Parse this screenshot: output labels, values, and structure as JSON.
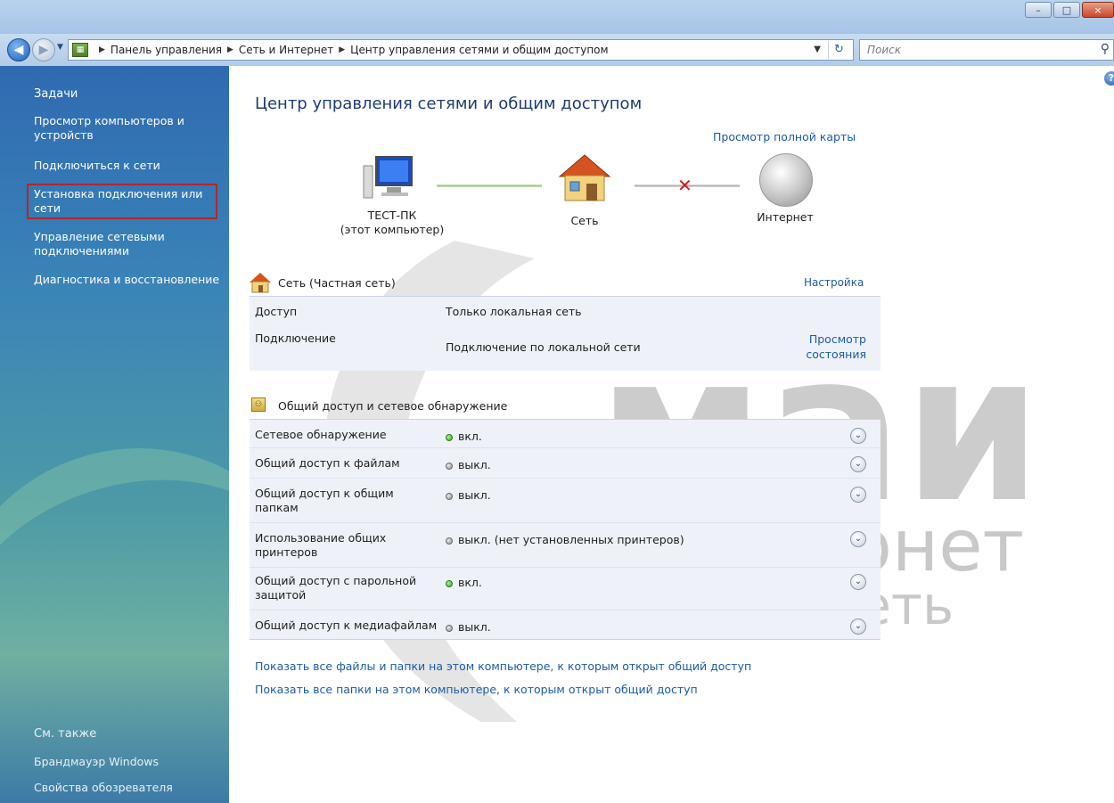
{
  "window": {
    "buttons": {
      "minimize": "–",
      "maximize": "□",
      "close": "×"
    }
  },
  "address_bar": {
    "crumbs": [
      "Панель управления",
      "Сеть и Интернет",
      "Центр управления сетями и общим доступом"
    ],
    "search_placeholder": "Поиск"
  },
  "sidebar": {
    "tasks_header": "Задачи",
    "items": [
      {
        "label": "Просмотр компьютеров и устройств"
      },
      {
        "label": "Подключиться к сети"
      },
      {
        "label": "Установка подключения или сети"
      },
      {
        "label": "Управление сетевыми подключениями"
      },
      {
        "label": "Диагностика и восстановление"
      }
    ],
    "see_also_header": "См. также",
    "see_also": [
      {
        "label": "Брандмауэр Windows"
      },
      {
        "label": "Свойства обозревателя"
      }
    ]
  },
  "main": {
    "title": "Центр управления сетями и общим доступом",
    "map_link": "Просмотр полной карты",
    "nodes": {
      "pc_name": "ТЕСТ-ПК",
      "pc_sub": "(этот компьютер)",
      "network": "Сеть",
      "internet": "Интернет"
    },
    "network_section": {
      "title": "Сеть (Частная сеть)",
      "customize_link": "Настройка",
      "access_label": "Доступ",
      "access_value": "Только локальная сеть",
      "connection_label": "Подключение",
      "connection_value": "Подключение по локальной сети",
      "view_status_link_1": "Просмотр",
      "view_status_link_2": "состояния"
    },
    "sharing_section": {
      "title": "Общий доступ и сетевое обнаружение",
      "rows": [
        {
          "label": "Сетевое обнаружение",
          "label2": "",
          "status": "вкл.",
          "on": true
        },
        {
          "label": "Общий доступ к файлам",
          "label2": "",
          "status": "выкл.",
          "on": false
        },
        {
          "label": "Общий доступ к общим",
          "label2": "папкам",
          "status": "выкл.",
          "on": false
        },
        {
          "label": "Использование общих",
          "label2": "принтеров",
          "status": "выкл. (нет установленных принтеров)",
          "on": false
        },
        {
          "label": "Общий доступ с парольной",
          "label2": "защитой",
          "status": "вкл.",
          "on": true
        },
        {
          "label": "Общий доступ к медиафайлам",
          "label2": "",
          "status": "выкл.",
          "on": false
        }
      ]
    },
    "bottom_links": [
      "Показать все файлы и папки на этом компьютере, к которым открыт общий доступ",
      "Показать все папки на этом компьютере, к которым открыт общий доступ"
    ]
  },
  "watermark": {
    "line1": "маил",
    "line2": "интернет",
    "line3": "сеть"
  }
}
